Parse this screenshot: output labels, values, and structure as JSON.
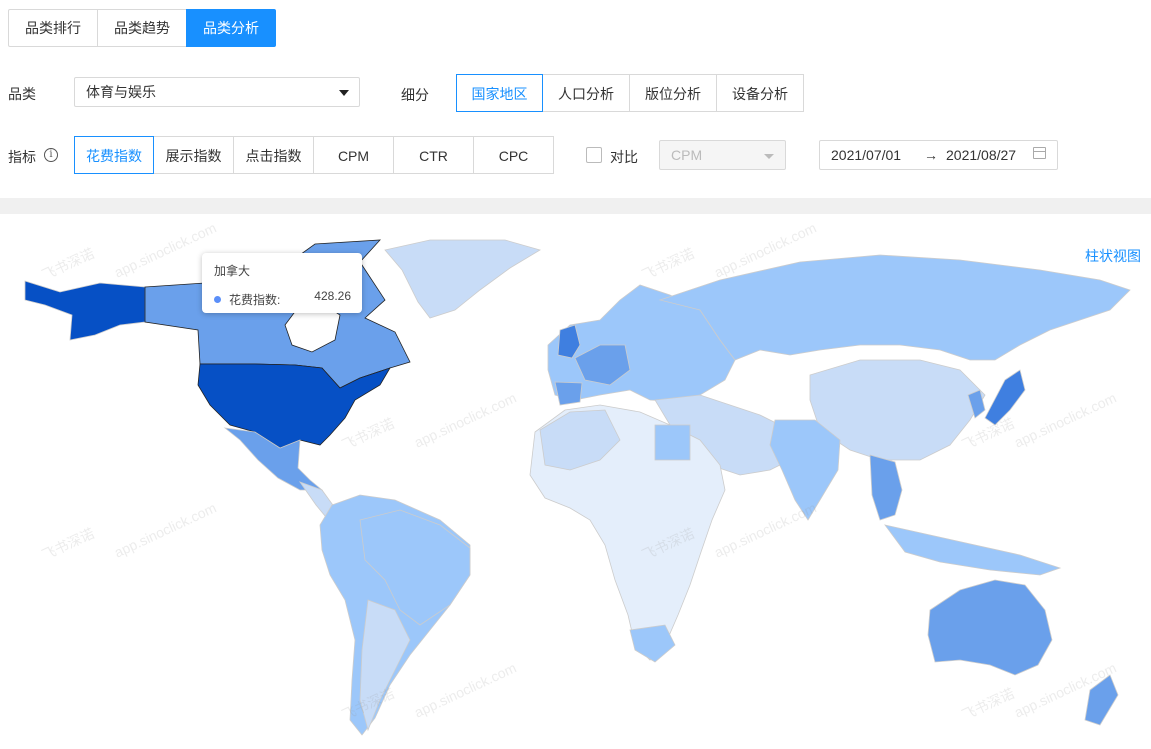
{
  "tabs": [
    {
      "label": "品类排行",
      "active": false
    },
    {
      "label": "品类趋势",
      "active": false
    },
    {
      "label": "品类分析",
      "active": true
    }
  ],
  "filters": {
    "category_label": "品类",
    "category_value": "体育与娱乐",
    "segment_label": "细分",
    "segments": [
      {
        "label": "国家地区",
        "active": true
      },
      {
        "label": "人口分析",
        "active": false
      },
      {
        "label": "版位分析",
        "active": false
      },
      {
        "label": "设备分析",
        "active": false
      }
    ],
    "metric_label": "指标",
    "metrics": [
      {
        "label": "花费指数",
        "active": true
      },
      {
        "label": "展示指数",
        "active": false
      },
      {
        "label": "点击指数",
        "active": false
      },
      {
        "label": "CPM",
        "active": false
      },
      {
        "label": "CTR",
        "active": false
      },
      {
        "label": "CPC",
        "active": false
      }
    ],
    "compare_label": "对比",
    "compare_value": "CPM",
    "date_start": "2021/07/01",
    "date_end": "2021/08/27"
  },
  "map": {
    "view_toggle_label": "柱状视图",
    "tooltip": {
      "country": "加拿大",
      "metric": "花费指数:",
      "value": "428.26"
    },
    "watermark_text": "飞书深诺",
    "watermark_url": "app.sinoclick.com",
    "colors": {
      "highest": "#0650c5",
      "high": "#3f7fe0",
      "mid": "#6aa0eb",
      "low": "#9cc7fa",
      "lower": "#c8dcf7",
      "lowest": "#e4eefb",
      "none": "#ffffff"
    }
  }
}
